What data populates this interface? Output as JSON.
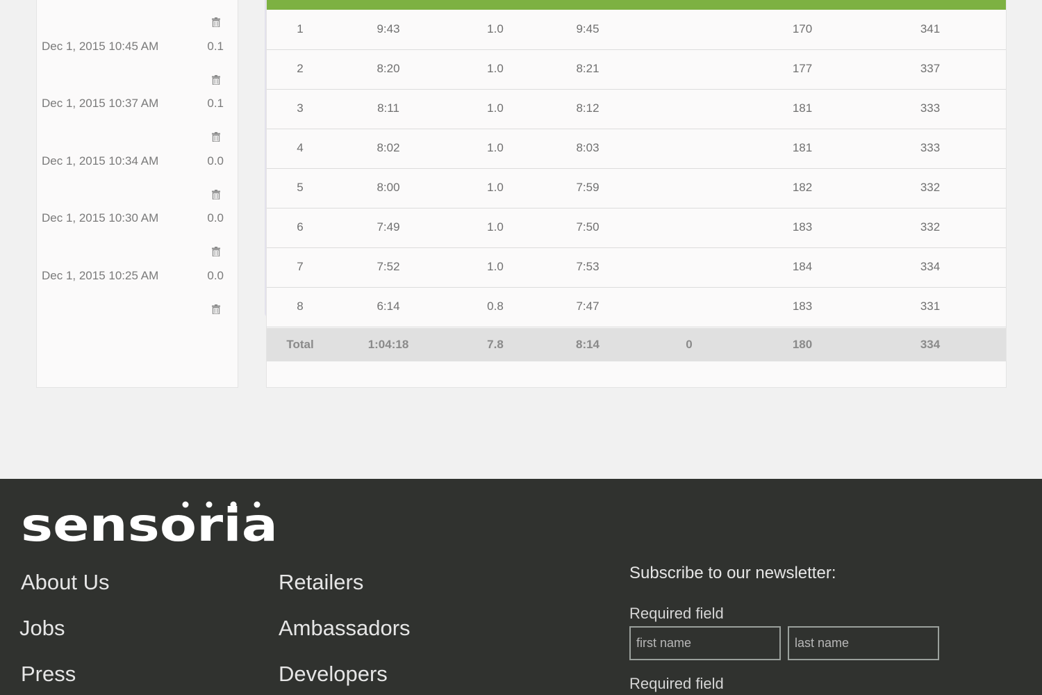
{
  "activities": [
    {
      "date": "Dec 1, 2015 10:45 AM",
      "value": "0.1"
    },
    {
      "date": "Dec 1, 2015 10:37 AM",
      "value": "0.1"
    },
    {
      "date": "Dec 1, 2015 10:34 AM",
      "value": "0.0"
    },
    {
      "date": "Dec 1, 2015 10:30 AM",
      "value": "0.0"
    },
    {
      "date": "Dec 1, 2015 10:25 AM",
      "value": "0.0"
    }
  ],
  "splits": [
    [
      "1",
      "9:43",
      "1.0",
      "9:45",
      "",
      "170",
      "341"
    ],
    [
      "2",
      "8:20",
      "1.0",
      "8:21",
      "",
      "177",
      "337"
    ],
    [
      "3",
      "8:11",
      "1.0",
      "8:12",
      "",
      "181",
      "333"
    ],
    [
      "4",
      "8:02",
      "1.0",
      "8:03",
      "",
      "181",
      "333"
    ],
    [
      "5",
      "8:00",
      "1.0",
      "7:59",
      "",
      "182",
      "332"
    ],
    [
      "6",
      "7:49",
      "1.0",
      "7:50",
      "",
      "183",
      "332"
    ],
    [
      "7",
      "7:52",
      "1.0",
      "7:53",
      "",
      "184",
      "334"
    ],
    [
      "8",
      "6:14",
      "0.8",
      "7:47",
      "",
      "183",
      "331"
    ]
  ],
  "total": [
    "Total",
    "1:04:18",
    "7.8",
    "8:14",
    "0",
    "180",
    "334"
  ],
  "footer": {
    "logo_text": "sensoria",
    "links_col1": [
      "About Us",
      "Jobs",
      "Press"
    ],
    "links_col2": [
      "Retailers",
      "Ambassadors",
      "Developers"
    ],
    "newsletter_title": "Subscribe to our newsletter:",
    "required_label": "Required field",
    "first_name_placeholder": "first name",
    "last_name_placeholder": "last name",
    "brand_color": "#7db142"
  },
  "icons": {
    "delete": "trash-icon"
  }
}
